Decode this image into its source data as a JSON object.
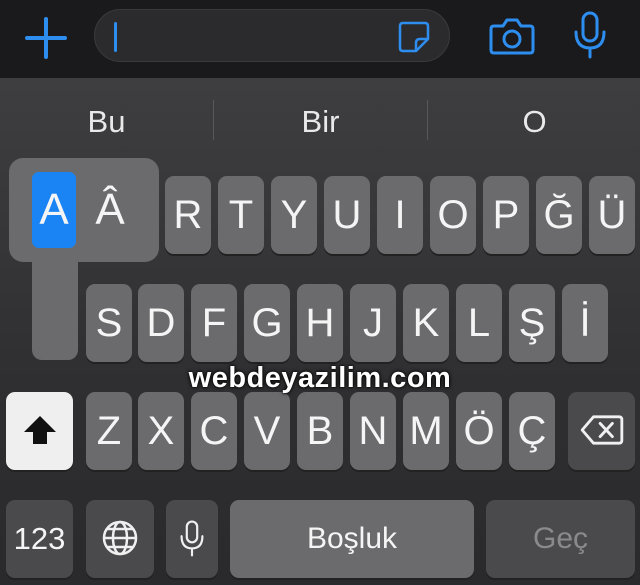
{
  "input_bar": {
    "add_icon": "plus-icon",
    "sticker_icon": "sticker-icon",
    "camera_icon": "camera-icon",
    "mic_icon": "microphone-icon",
    "accent_color": "#2e8ef0"
  },
  "suggestions": [
    "Bu",
    "Bir",
    "O"
  ],
  "accent_popup": {
    "options": [
      "A",
      "Â"
    ],
    "selected": "A",
    "selected_color": "#1a84f5"
  },
  "row1": [
    "R",
    "T",
    "Y",
    "U",
    "I",
    "O",
    "P",
    "Ğ",
    "Ü"
  ],
  "row2": [
    "S",
    "D",
    "F",
    "G",
    "H",
    "J",
    "K",
    "L",
    "Ş",
    "İ"
  ],
  "row3": [
    "Z",
    "X",
    "C",
    "V",
    "B",
    "N",
    "M",
    "Ö",
    "Ç"
  ],
  "bottom": {
    "numbers": "123",
    "space": "Boşluk",
    "go": "Geç"
  },
  "watermark": "webdeyazilim.com"
}
